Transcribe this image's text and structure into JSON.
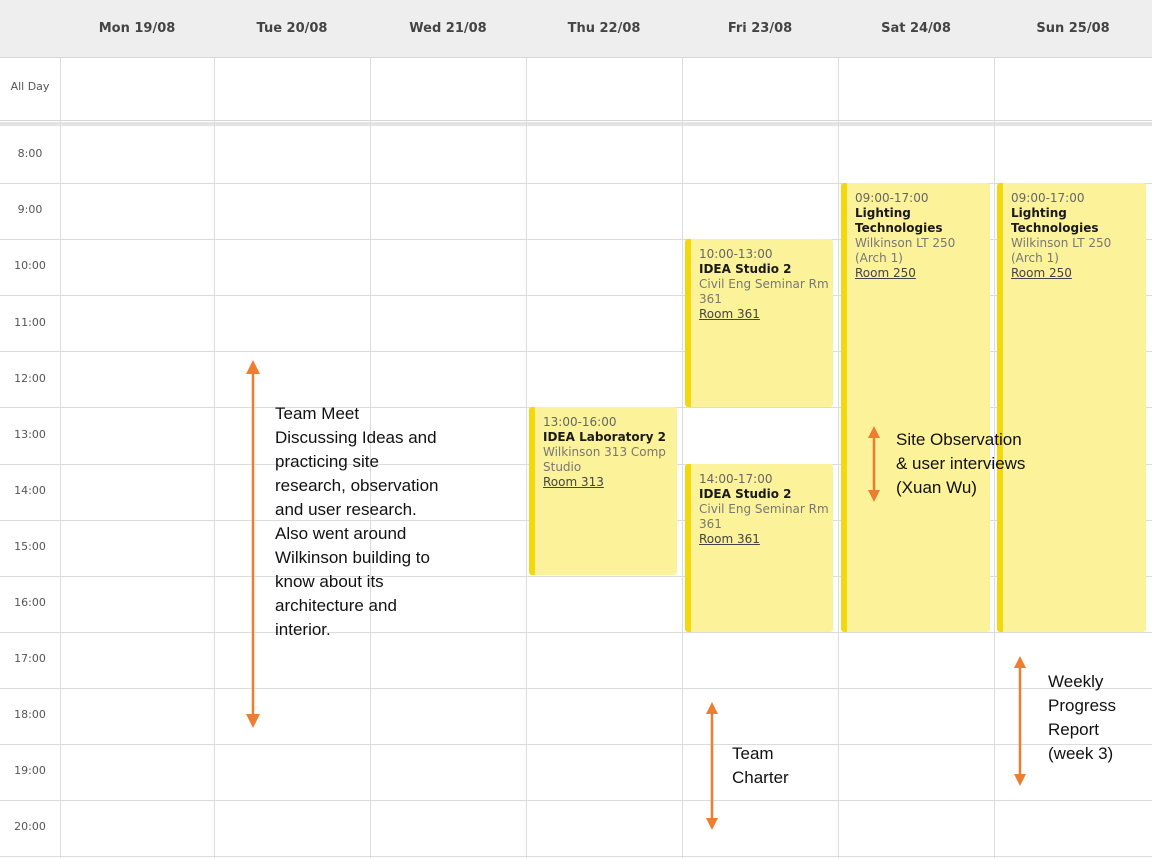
{
  "calendar": {
    "days": [
      "Mon 19/08",
      "Tue 20/08",
      "Wed 21/08",
      "Thu 22/08",
      "Fri 23/08",
      "Sat 24/08",
      "Sun 25/08"
    ],
    "all_day_label": "All Day",
    "hours": [
      "8:00",
      "9:00",
      "10:00",
      "11:00",
      "12:00",
      "13:00",
      "14:00",
      "15:00",
      "16:00",
      "17:00",
      "18:00",
      "19:00",
      "20:00"
    ]
  },
  "events": [
    {
      "time": "10:00-13:00",
      "title": "IDEA Studio 2",
      "location": "Civil Eng Seminar Rm 361",
      "room": "Room 361"
    },
    {
      "time": "14:00-17:00",
      "title": "IDEA Studio 2",
      "location": "Civil Eng Seminar Rm 361",
      "room": "Room 361"
    },
    {
      "time": "13:00-16:00",
      "title": "IDEA Laboratory 2",
      "location": "Wilkinson 313 Comp Studio",
      "room": "Room 313"
    },
    {
      "time": "09:00-17:00",
      "title": "Lighting Technologies",
      "location": "Wilkinson LT 250 (Arch 1)",
      "room": "Room 250"
    },
    {
      "time": "09:00-17:00",
      "title": "Lighting Technologies",
      "location": "Wilkinson LT 250 (Arch 1)",
      "room": "Room 250"
    }
  ],
  "annotations": {
    "team_meet": "Team Meet\nDiscussing Ideas and\npracticing site\nresearch, observation\nand user research.\nAlso went around\nWilkinson building to\nknow about its\narchitecture and\ninterior.",
    "site_observation": "Site Observation\n& user interviews\n(Xuan Wu)",
    "team_charter": "Team\nCharter",
    "weekly_report": "Weekly\nProgress\nReport\n(week 3)",
    "arrow_color": "#ed7d31"
  },
  "colors": {
    "event_fill": "#fcf29a",
    "event_accent": "#f3d80e",
    "header_bg": "#eeeeee"
  }
}
